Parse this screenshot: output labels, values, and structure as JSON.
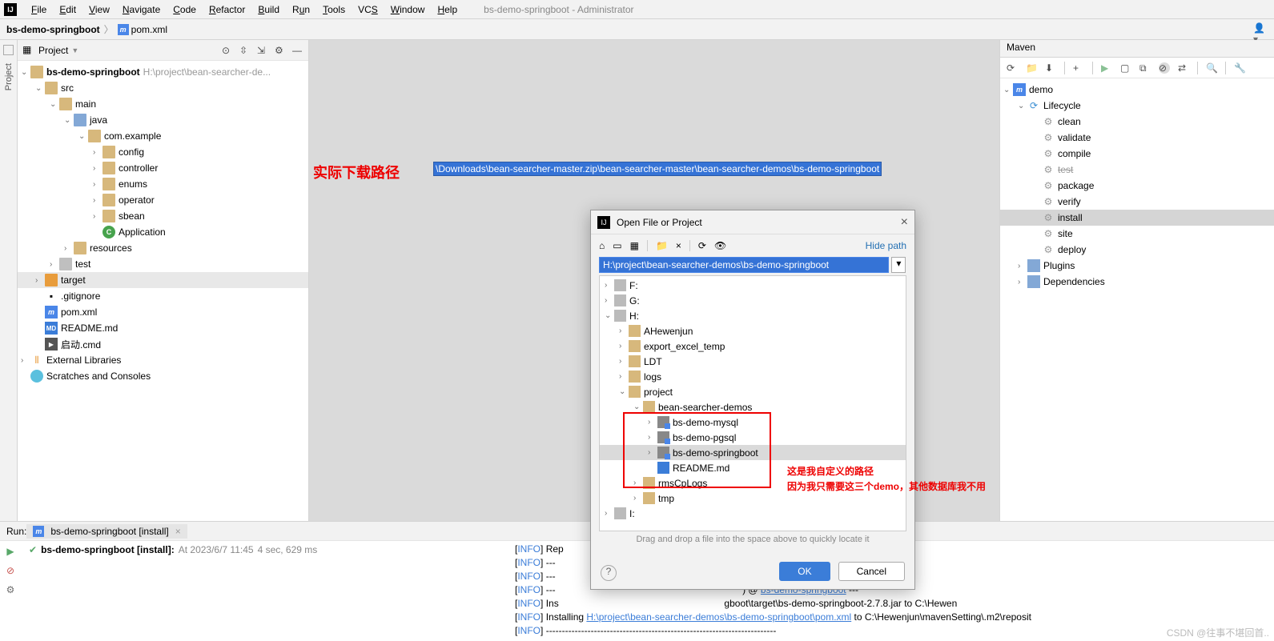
{
  "window": {
    "title": "bs-demo-springboot - Administrator"
  },
  "menu": {
    "file": "File",
    "edit": "Edit",
    "view": "View",
    "navigate": "Navigate",
    "code": "Code",
    "refactor": "Refactor",
    "build": "Build",
    "run": "Run",
    "tools": "Tools",
    "vcs": "VCS",
    "window": "Window",
    "help": "Help"
  },
  "nav": {
    "crumb": "bs-demo-springboot",
    "file": "pom.xml",
    "file_icon": "m"
  },
  "gutter_left": "Project",
  "project_panel": {
    "title": "Project",
    "tree": {
      "root": "bs-demo-springboot",
      "root_path": "H:\\project\\bean-searcher-de...",
      "src": "src",
      "main": "main",
      "java": "java",
      "pkg": "com.example",
      "folders": [
        "config",
        "controller",
        "enums",
        "operator",
        "sbean"
      ],
      "app": "Application",
      "resources": "resources",
      "test": "test",
      "target": "target",
      "gitignore": ".gitignore",
      "pom": "pom.xml",
      "readme": "README.md",
      "cmd": "启动.cmd",
      "ext": "External Libraries",
      "scratch": "Scratches and Consoles"
    }
  },
  "editor": {
    "label1": "实际下载路径",
    "path": "\\Downloads\\bean-searcher-master.zip\\bean-searcher-master\\bean-searcher-demos\\bs-demo-springboot"
  },
  "maven": {
    "title": "Maven",
    "root": "demo",
    "lifecycle": "Lifecycle",
    "phases": [
      "clean",
      "validate",
      "compile",
      "test",
      "package",
      "verify",
      "install",
      "site",
      "deploy"
    ],
    "plugins": "Plugins",
    "deps": "Dependencies"
  },
  "run": {
    "label": "Run:",
    "tab": "bs-demo-springboot [install]",
    "status": "bs-demo-springboot [install]:",
    "at": "At 2023/6/7 11:45",
    "timing": "4 sec, 629 ms",
    "console": [
      {
        "tag": "[INFO]",
        "text": " Rep"
      },
      {
        "tag": "[INFO]",
        "text": " ---"
      },
      {
        "tag": "[INFO]",
        "text": " ---"
      },
      {
        "tag": "[INFO]",
        "text": " --- ",
        "text2": ") @ ",
        "link": "bs-demo-springboot",
        "text3": " ---"
      },
      {
        "tag": "[INFO]",
        "text": " Ins",
        "text2": "gboot\\target\\bs-demo-springboot-2.7.8.jar to C:\\Hewen"
      },
      {
        "tag": "[INFO]",
        "text": " Installing ",
        "link": "H:\\project\\bean-searcher-demos\\bs-demo-springboot\\pom.xml",
        "text2": " to C:\\Hewenjun\\mavenSetting\\.m2\\reposit"
      },
      {
        "tag": "[INFO]",
        "text": " ------------------------------------------------------------------------"
      }
    ]
  },
  "dialog": {
    "title": "Open File or Project",
    "hide": "Hide path",
    "path": "H:\\project\\bean-searcher-demos\\bs-demo-springboot",
    "drives": {
      "f": "F:",
      "g": "G:",
      "h": "H:"
    },
    "h_folders": [
      "AHewenjun",
      "export_excel_temp",
      "LDT",
      "logs",
      "project"
    ],
    "bsd": "bean-searcher-demos",
    "mods": [
      "bs-demo-mysql",
      "bs-demo-pgsql",
      "bs-demo-springboot"
    ],
    "readme": "README.md",
    "rms": "rmsCpLogs",
    "tmp": "tmp",
    "i": "I:",
    "hint": "Drag and drop a file into the space above to quickly locate it",
    "ok": "OK",
    "cancel": "Cancel"
  },
  "annotation2": {
    "l1": "这是我自定义的路径",
    "l2": "因为我只需要这三个demo，其他数据库我不用"
  },
  "watermark": "CSDN @往事不堪回首.."
}
